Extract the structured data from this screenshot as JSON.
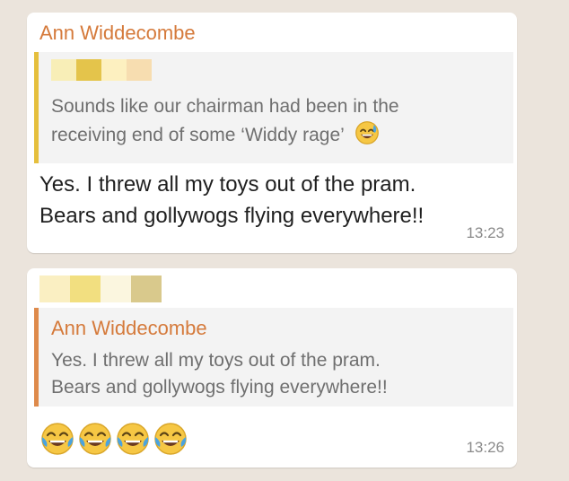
{
  "messages": [
    {
      "sender": "Ann Widdecombe",
      "quote": {
        "line1": "Sounds like our chairman had been in the",
        "line2": "receiving end of some ‘Widdy rage’",
        "emoji": "grinning-face-with-sweat-icon",
        "redaction_colors": [
          "#f8eeb7",
          "#e4c44b",
          "#fdf0c0",
          "#f7ddb0"
        ]
      },
      "text_line1": "Yes. I threw all my toys out of the pram.",
      "text_line2": "Bears and gollywogs flying everywhere!!",
      "time": "13:23"
    },
    {
      "redaction_colors": [
        "#faefc2",
        "#f2df80",
        "#fbf6df",
        "#d9c98c"
      ],
      "quote": {
        "author": "Ann Widdecombe",
        "line1": "Yes. I threw all my toys out of the pram.",
        "line2": "Bears and gollywogs flying everywhere!!"
      },
      "emojis": [
        "face-with-tears-of-joy-icon",
        "face-with-tears-of-joy-icon",
        "face-with-tears-of-joy-icon",
        "face-with-tears-of-joy-icon"
      ],
      "time": "13:26"
    }
  ],
  "colors": {
    "accent_name": "#d57a3b",
    "quote_bar_1": "#e5bf3d",
    "quote_bar_2": "#de8a4b",
    "bubble": "#ffffff",
    "background": "#ebe4dc"
  }
}
